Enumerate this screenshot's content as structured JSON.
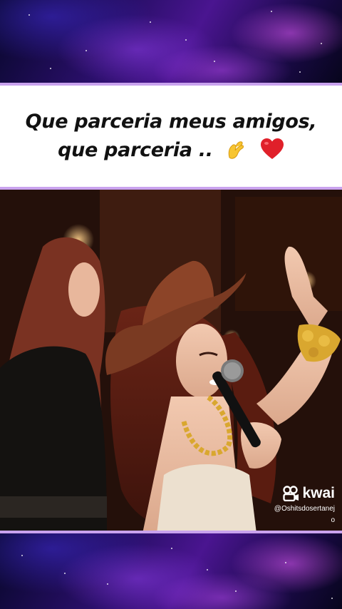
{
  "caption": {
    "line1": "Que parceria meus amigos,",
    "line2": "que parceria ..",
    "emojis": [
      "pinching-hand-emoji",
      "red-heart-emoji"
    ]
  },
  "video": {
    "scene": "concert performance video"
  },
  "watermark": {
    "brand": "kwai",
    "handle": "@Oshitsdosertanej",
    "handle_wrap": "o"
  },
  "colors": {
    "band_border": "#c9a2ee",
    "heart": "#e0202a",
    "hat": "#7a3a22"
  }
}
